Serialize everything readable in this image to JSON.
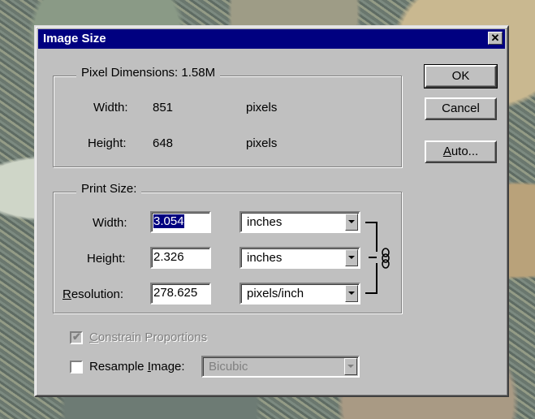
{
  "dialog": {
    "title": "Image Size",
    "close_glyph": "✕"
  },
  "pixel_dimensions": {
    "legend": "Pixel Dimensions:",
    "size": "1.58M",
    "width_label": "Width:",
    "width_value": "851",
    "width_unit": "pixels",
    "height_label": "Height:",
    "height_value": "648",
    "height_unit": "pixels"
  },
  "print_size": {
    "legend": "Print Size:",
    "width_label": "Width:",
    "width_value": "3.054",
    "width_unit": "inches",
    "height_label": "Height:",
    "height_value": "2.326",
    "height_unit": "inches",
    "resolution_label_first": "R",
    "resolution_label_rest": "esolution:",
    "resolution_value": "278.625",
    "resolution_unit": "pixels/inch",
    "link_icon": "chain-link-icon"
  },
  "buttons": {
    "ok": "OK",
    "cancel": "Cancel",
    "auto_first": "A",
    "auto_rest": "uto..."
  },
  "options": {
    "constrain_first": "C",
    "constrain_rest": "onstrain Proportions",
    "constrain_checked": true,
    "constrain_enabled": false,
    "resample_label": "Resample ",
    "resample_label_first": "I",
    "resample_label_rest": "mage:",
    "resample_checked": false,
    "resample_method": "Bicubic"
  },
  "colors": {
    "title_bar": "#000080",
    "dialog_face": "#c0c0c0",
    "selection": "#000080"
  }
}
